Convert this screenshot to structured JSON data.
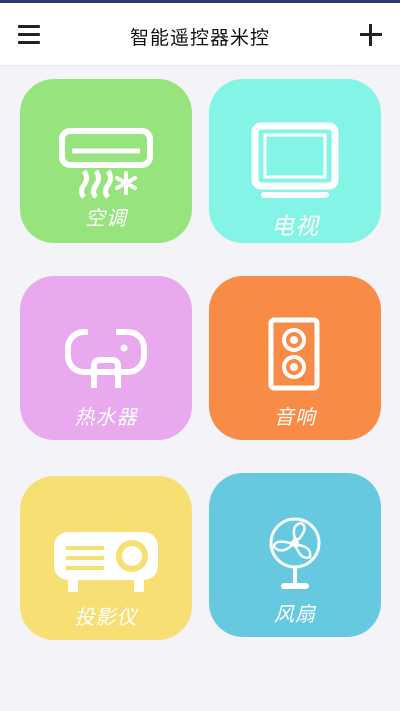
{
  "header": {
    "title": "智能遥控器米控",
    "menu_icon": "hamburger-menu-icon",
    "add_icon": "plus-icon"
  },
  "devices": [
    {
      "label": "空调",
      "icon": "air-conditioner-icon",
      "color": "#97e47e"
    },
    {
      "label": "电视",
      "icon": "tv-icon",
      "color": "#83f4e5"
    },
    {
      "label": "热水器",
      "icon": "water-heater-icon",
      "color": "#e8a9ef"
    },
    {
      "label": "音响",
      "icon": "speaker-icon",
      "color": "#f88b45"
    },
    {
      "label": "投影仪",
      "icon": "projector-icon",
      "color": "#f8df74"
    },
    {
      "label": "风扇",
      "icon": "fan-icon",
      "color": "#66c9e0"
    }
  ],
  "colors": {
    "background": "#f3f3f8",
    "header": "#ffffff",
    "top_accent": "#2b3a6b"
  }
}
